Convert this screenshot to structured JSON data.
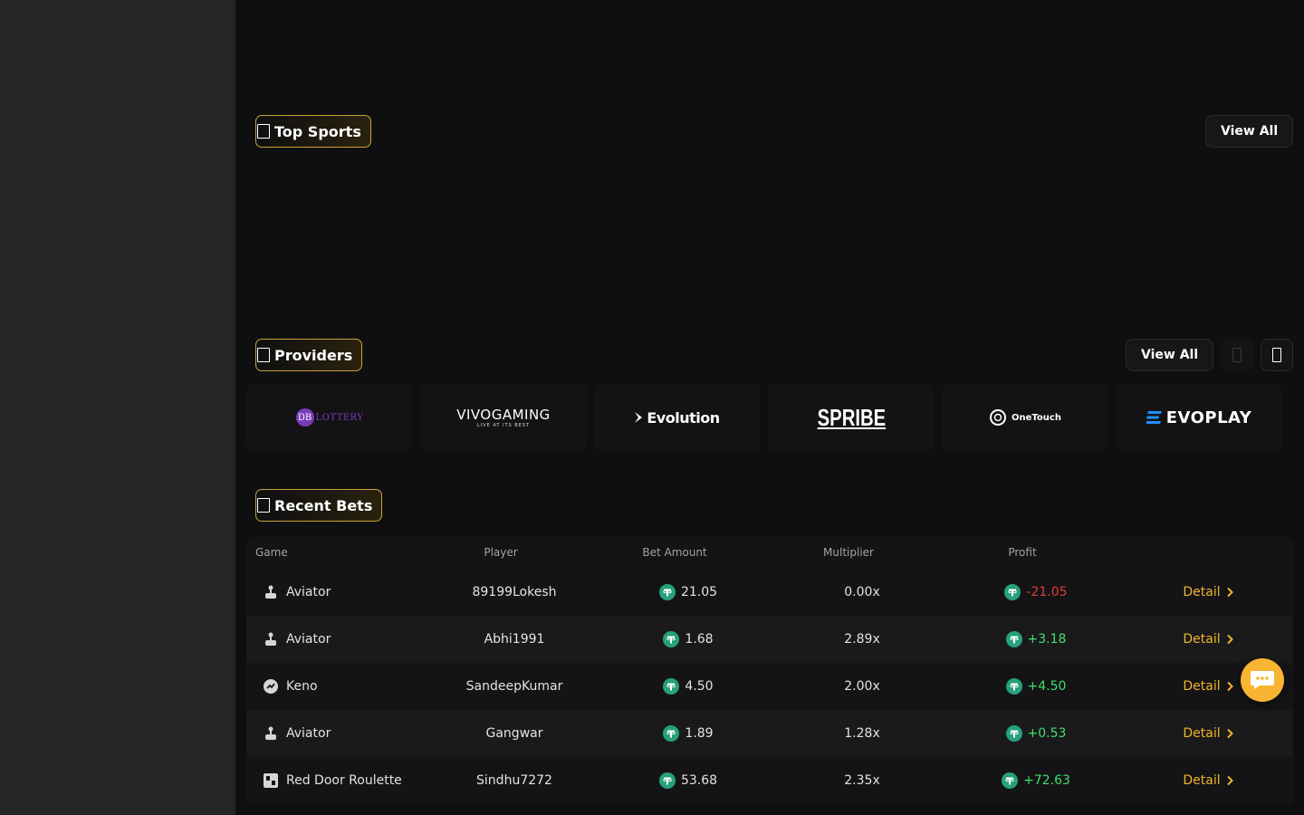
{
  "colors": {
    "accent": "#f0b429",
    "sidebar_bg": "#252527",
    "main_bg": "#0f0f11",
    "positive": "#3ee06d",
    "negative": "#e53935",
    "usdt": "#26a17b"
  },
  "top_sports": {
    "title": "Top Sports",
    "view_all": "View All",
    "icon": "missing-glyph-icon"
  },
  "providers": {
    "title": "Providers",
    "view_all": "View All",
    "prev_icon": "chevron-left-icon",
    "next_icon": "chevron-right-icon",
    "items": [
      {
        "name": "DB LOTTERY",
        "logo_text": "LOTTERY",
        "logo_mark": "DB"
      },
      {
        "name": "VIVO GAMING",
        "logo_text": "VIVOGAMING",
        "tagline": "LIVE AT ITS BEST"
      },
      {
        "name": "Evolution",
        "logo_text": "Evolution"
      },
      {
        "name": "SPRIBE",
        "logo_text": "SPRIBE"
      },
      {
        "name": "OneTouch",
        "logo_text": "OneTouch"
      },
      {
        "name": "EVOPLAY",
        "logo_text": "EVOPLAY"
      }
    ]
  },
  "recent_bets": {
    "title": "Recent Bets",
    "columns": {
      "game": "Game",
      "player": "Player",
      "bet_amount": "Bet Amount",
      "multiplier": "Multiplier",
      "profit": "Profit"
    },
    "rows": [
      {
        "game": "Aviator",
        "icon": "joystick-icon",
        "player": "89199Lokesh",
        "amount": "21.05",
        "multiplier": "0.00x",
        "profit": "-21.05",
        "profit_sign": "neg",
        "detail": "Detail"
      },
      {
        "game": "Aviator",
        "icon": "joystick-icon",
        "player": "Abhi1991",
        "amount": "1.68",
        "multiplier": "2.89x",
        "profit": "+3.18",
        "profit_sign": "pos",
        "detail": "Detail"
      },
      {
        "game": "Keno",
        "icon": "keno-icon",
        "player": "SandeepKumar",
        "amount": "4.50",
        "multiplier": "2.00x",
        "profit": "+4.50",
        "profit_sign": "pos",
        "detail": "Detail"
      },
      {
        "game": "Aviator",
        "icon": "joystick-icon",
        "player": "Gangwar",
        "amount": "1.89",
        "multiplier": "1.28x",
        "profit": "+0.53",
        "profit_sign": "pos",
        "detail": "Detail"
      },
      {
        "game": "Red Door Roulette",
        "icon": "cards-icon",
        "player": "Sindhu7272",
        "amount": "53.68",
        "multiplier": "2.35x",
        "profit": "+72.63",
        "profit_sign": "pos",
        "detail": "Detail"
      }
    ]
  },
  "chat": {
    "icon": "chat-bubble-icon"
  }
}
